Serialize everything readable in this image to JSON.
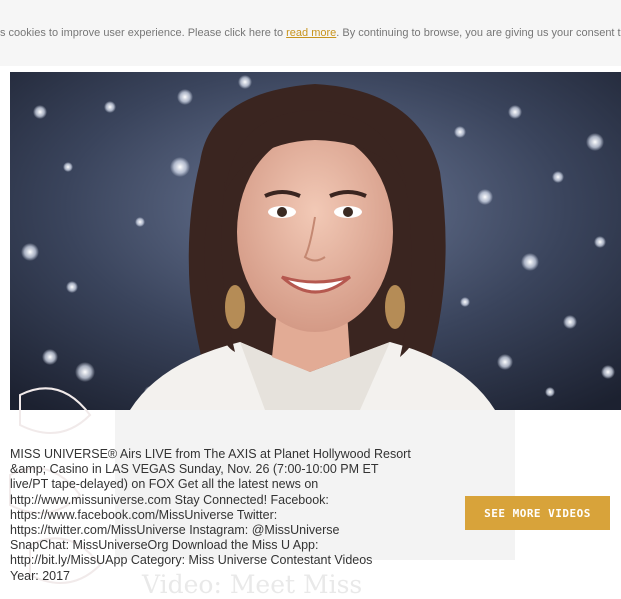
{
  "cookie_bar": {
    "text_before": "s cookies to improve user experience. Please click here to ",
    "link_text": "read more",
    "text_after": ". By continuing to browse, you are giving us your consent to c"
  },
  "video": {
    "description": "MISS UNIVERSE® Airs LIVE from The AXIS at Planet Hollywood Resort\n&amp; Casino in LAS VEGAS Sunday, Nov. 26 (7:00-10:00 PM ET\nlive/PT tape-delayed) on FOX Get all the latest news on\nhttp://www.missuniverse.com Stay Connected! Facebook:\nhttps://www.facebook.com/MissUniverse Twitter:\nhttps://twitter.com/MissUniverse Instagram: @MissUniverse\nSnapChat: MissUniverseOrg Download the Miss U App:\nhttp://bit.ly/MissUApp Category: Miss Universe Contestant Videos\nYear: 2017",
    "see_more_label": "SEE MORE VIDEOS"
  },
  "background": {
    "faded_title": "Video: Meet Miss"
  },
  "colors": {
    "accent": "#d8a33a",
    "link": "#c8941e",
    "cookie_bg": "#f6f6f6",
    "text": "#333333"
  }
}
